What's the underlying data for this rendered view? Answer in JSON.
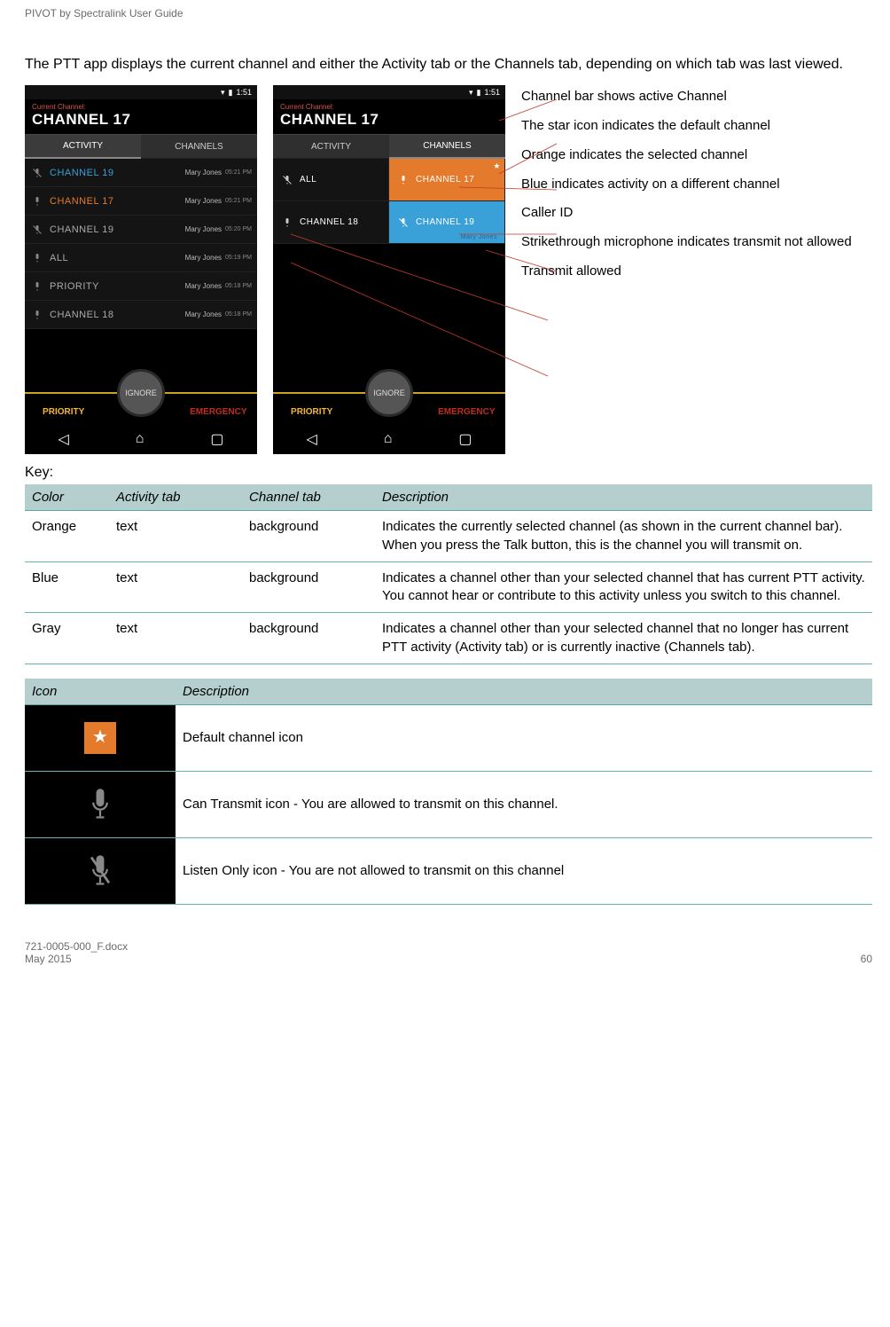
{
  "header": {
    "title": "PIVOT by Spectralink User Guide"
  },
  "intro": "The PTT app displays the current channel and either the Activity tab or the Channels tab, depending on which tab was last viewed.",
  "phone": {
    "time": "1:51",
    "current_label": "Current Channel:",
    "current_channel": "CHANNEL 17",
    "tabs": {
      "activity": "ACTIVITY",
      "channels": "CHANNELS"
    },
    "activity_rows": [
      {
        "name": "CHANNEL 19",
        "color": "blue",
        "caller": "Mary Jones",
        "time": "05:21 PM"
      },
      {
        "name": "CHANNEL 17",
        "color": "orange",
        "caller": "Mary Jones",
        "time": "05:21 PM"
      },
      {
        "name": "CHANNEL 19",
        "color": "gray",
        "caller": "Mary Jones",
        "time": "05:20 PM"
      },
      {
        "name": "ALL",
        "color": "gray",
        "caller": "Mary Jones",
        "time": "05:19 PM"
      },
      {
        "name": "PRIORITY",
        "color": "gray",
        "caller": "Mary Jones",
        "time": "05:18 PM"
      },
      {
        "name": "CHANNEL 18",
        "color": "gray",
        "caller": "Mary Jones",
        "time": "05:18 PM"
      }
    ],
    "channel_tiles": [
      {
        "name": "ALL",
        "bg": "dark",
        "mic": "mute"
      },
      {
        "name": "CHANNEL 17",
        "bg": "orange",
        "mic": "on",
        "star": true
      },
      {
        "name": "CHANNEL 18",
        "bg": "dark",
        "mic": "on"
      },
      {
        "name": "CHANNEL 19",
        "bg": "blue",
        "mic": "mute",
        "sub": "Mary Jones"
      }
    ],
    "footer": {
      "priority": "PRIORITY",
      "ignore": "IGNORE",
      "emergency": "EMERGENCY"
    }
  },
  "callouts": {
    "c1": "Channel bar shows active Channel",
    "c2": "The star icon indicates the default channel",
    "c3": "Orange indicates the selected channel",
    "c4": "Blue indicates activity on a different channel",
    "c5": "Caller ID",
    "c6": "Strikethrough microphone indicates transmit not allowed",
    "c7": "Transmit allowed"
  },
  "key_heading": "Key:",
  "color_table": {
    "headers": {
      "color": "Color",
      "activity": "Activity tab",
      "channel": "Channel tab",
      "desc": "Description"
    },
    "rows": [
      {
        "color": "Orange",
        "activity": "text",
        "channel": "background",
        "desc": "Indicates the currently selected channel (as shown in the current channel bar). When you press the Talk button, this is the channel you will transmit on."
      },
      {
        "color": "Blue",
        "activity": "text",
        "channel": "background",
        "desc": "Indicates a channel other than your selected channel that has current PTT activity. You cannot hear or contribute to this activity unless you switch to this channel."
      },
      {
        "color": "Gray",
        "activity": "text",
        "channel": "background",
        "desc": "Indicates a channel other than your selected channel that no longer has current PTT activity (Activity tab) or is currently inactive (Channels tab)."
      }
    ]
  },
  "icon_table": {
    "headers": {
      "icon": "Icon",
      "desc": "Description"
    },
    "rows": [
      {
        "desc": "Default channel icon"
      },
      {
        "desc": "Can Transmit icon  - You are allowed to transmit on this channel."
      },
      {
        "desc": "Listen Only icon  - You are not allowed to transmit on this channel"
      }
    ]
  },
  "footer": {
    "doc": "721-0005-000_F.docx",
    "date": "May 2015",
    "page": "60"
  }
}
